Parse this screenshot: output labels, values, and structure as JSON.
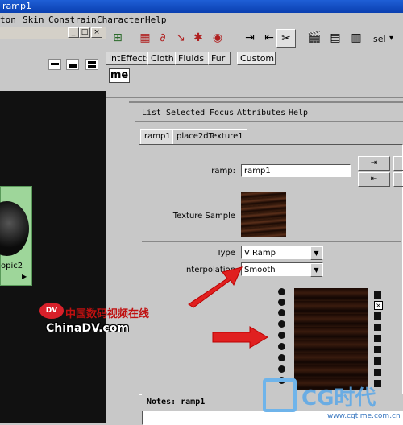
{
  "window": {
    "title": "ramp1"
  },
  "menubar": {
    "items": [
      "ton",
      "Skin",
      "Constrain",
      "Character",
      "Help"
    ]
  },
  "left_panel": {
    "node_label": "opic2",
    "window_buttons": [
      "□",
      "×"
    ]
  },
  "shelf": {
    "tabs": [
      "intEffects",
      "Cloth",
      "Fluids",
      "Fur",
      "Custom"
    ],
    "fragment": "me",
    "sel_label": "sel"
  },
  "attribute_editor": {
    "menu": [
      "List",
      "Selected",
      "Focus",
      "Attributes",
      "Help"
    ],
    "tabs": [
      "ramp1",
      "place2dTexture1"
    ],
    "ramp_label": "ramp:",
    "ramp_value": "ramp1",
    "texture_sample_label": "Texture Sample",
    "type_label": "Type",
    "type_value": "V Ramp",
    "interp_label": "Interpolation",
    "interp_value": "Smooth",
    "notes_label": "Notes:  ramp1"
  },
  "watermarks": {
    "chinadv_cn": "中国数码视频在线",
    "chinadv_en": "ChinaDV.com",
    "cg_logo": "CG时代",
    "cg_url": "www.cgtime.com.cn"
  },
  "colors": {
    "accent_arrow": "#e02020",
    "title_blue": "#0a3fb0",
    "node_green": "#9ed69a"
  }
}
